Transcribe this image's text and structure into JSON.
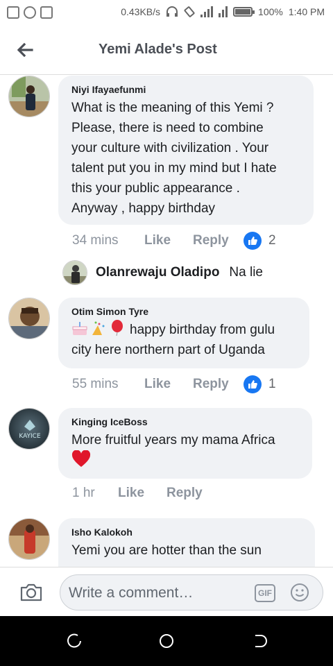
{
  "status_bar": {
    "network_speed": "0.43KB/s",
    "battery_percent": "100%",
    "time": "1:40 PM"
  },
  "header": {
    "title": "Yemi Alade's Post"
  },
  "comments": [
    {
      "author": "Niyi Ifayaefunmi",
      "lines": [
        "What is the meaning of this Yemi ?",
        "Please, there is need to combine",
        "your culture with civilization . Your",
        "talent put you in my mind but I hate",
        "this your public appearance .",
        "Anyway , happy birthday"
      ],
      "time": "34 mins",
      "like_label": "Like",
      "reply_label": "Reply",
      "reaction_count": "2"
    },
    {
      "author": "Otim Simon Tyre",
      "lines": [
        "happy birthday from gulu",
        "city here northern part of Uganda"
      ],
      "emojis": [
        "birthday-cake",
        "party-popper",
        "balloon"
      ],
      "time": "55 mins",
      "like_label": "Like",
      "reply_label": "Reply",
      "reaction_count": "1"
    },
    {
      "author": "Kinging IceBoss",
      "avatar_text": "KAYICE",
      "lines": [
        "More fruitful years my mama Africa"
      ],
      "emojis": [
        "red-heart"
      ],
      "time": "1 hr",
      "like_label": "Like",
      "reply_label": "Reply"
    },
    {
      "author": "Isho Kalokoh",
      "lines": [
        "Yemi you are hotter than the sun"
      ]
    }
  ],
  "reply_preview": {
    "author": "Olanrewaju Oladipo",
    "text": "Na lie"
  },
  "composer": {
    "placeholder": "Write a comment…",
    "gif_label": "GIF"
  },
  "colors": {
    "accent": "#1877f2",
    "bubble": "#f0f2f5",
    "meta": "#8d949e"
  }
}
